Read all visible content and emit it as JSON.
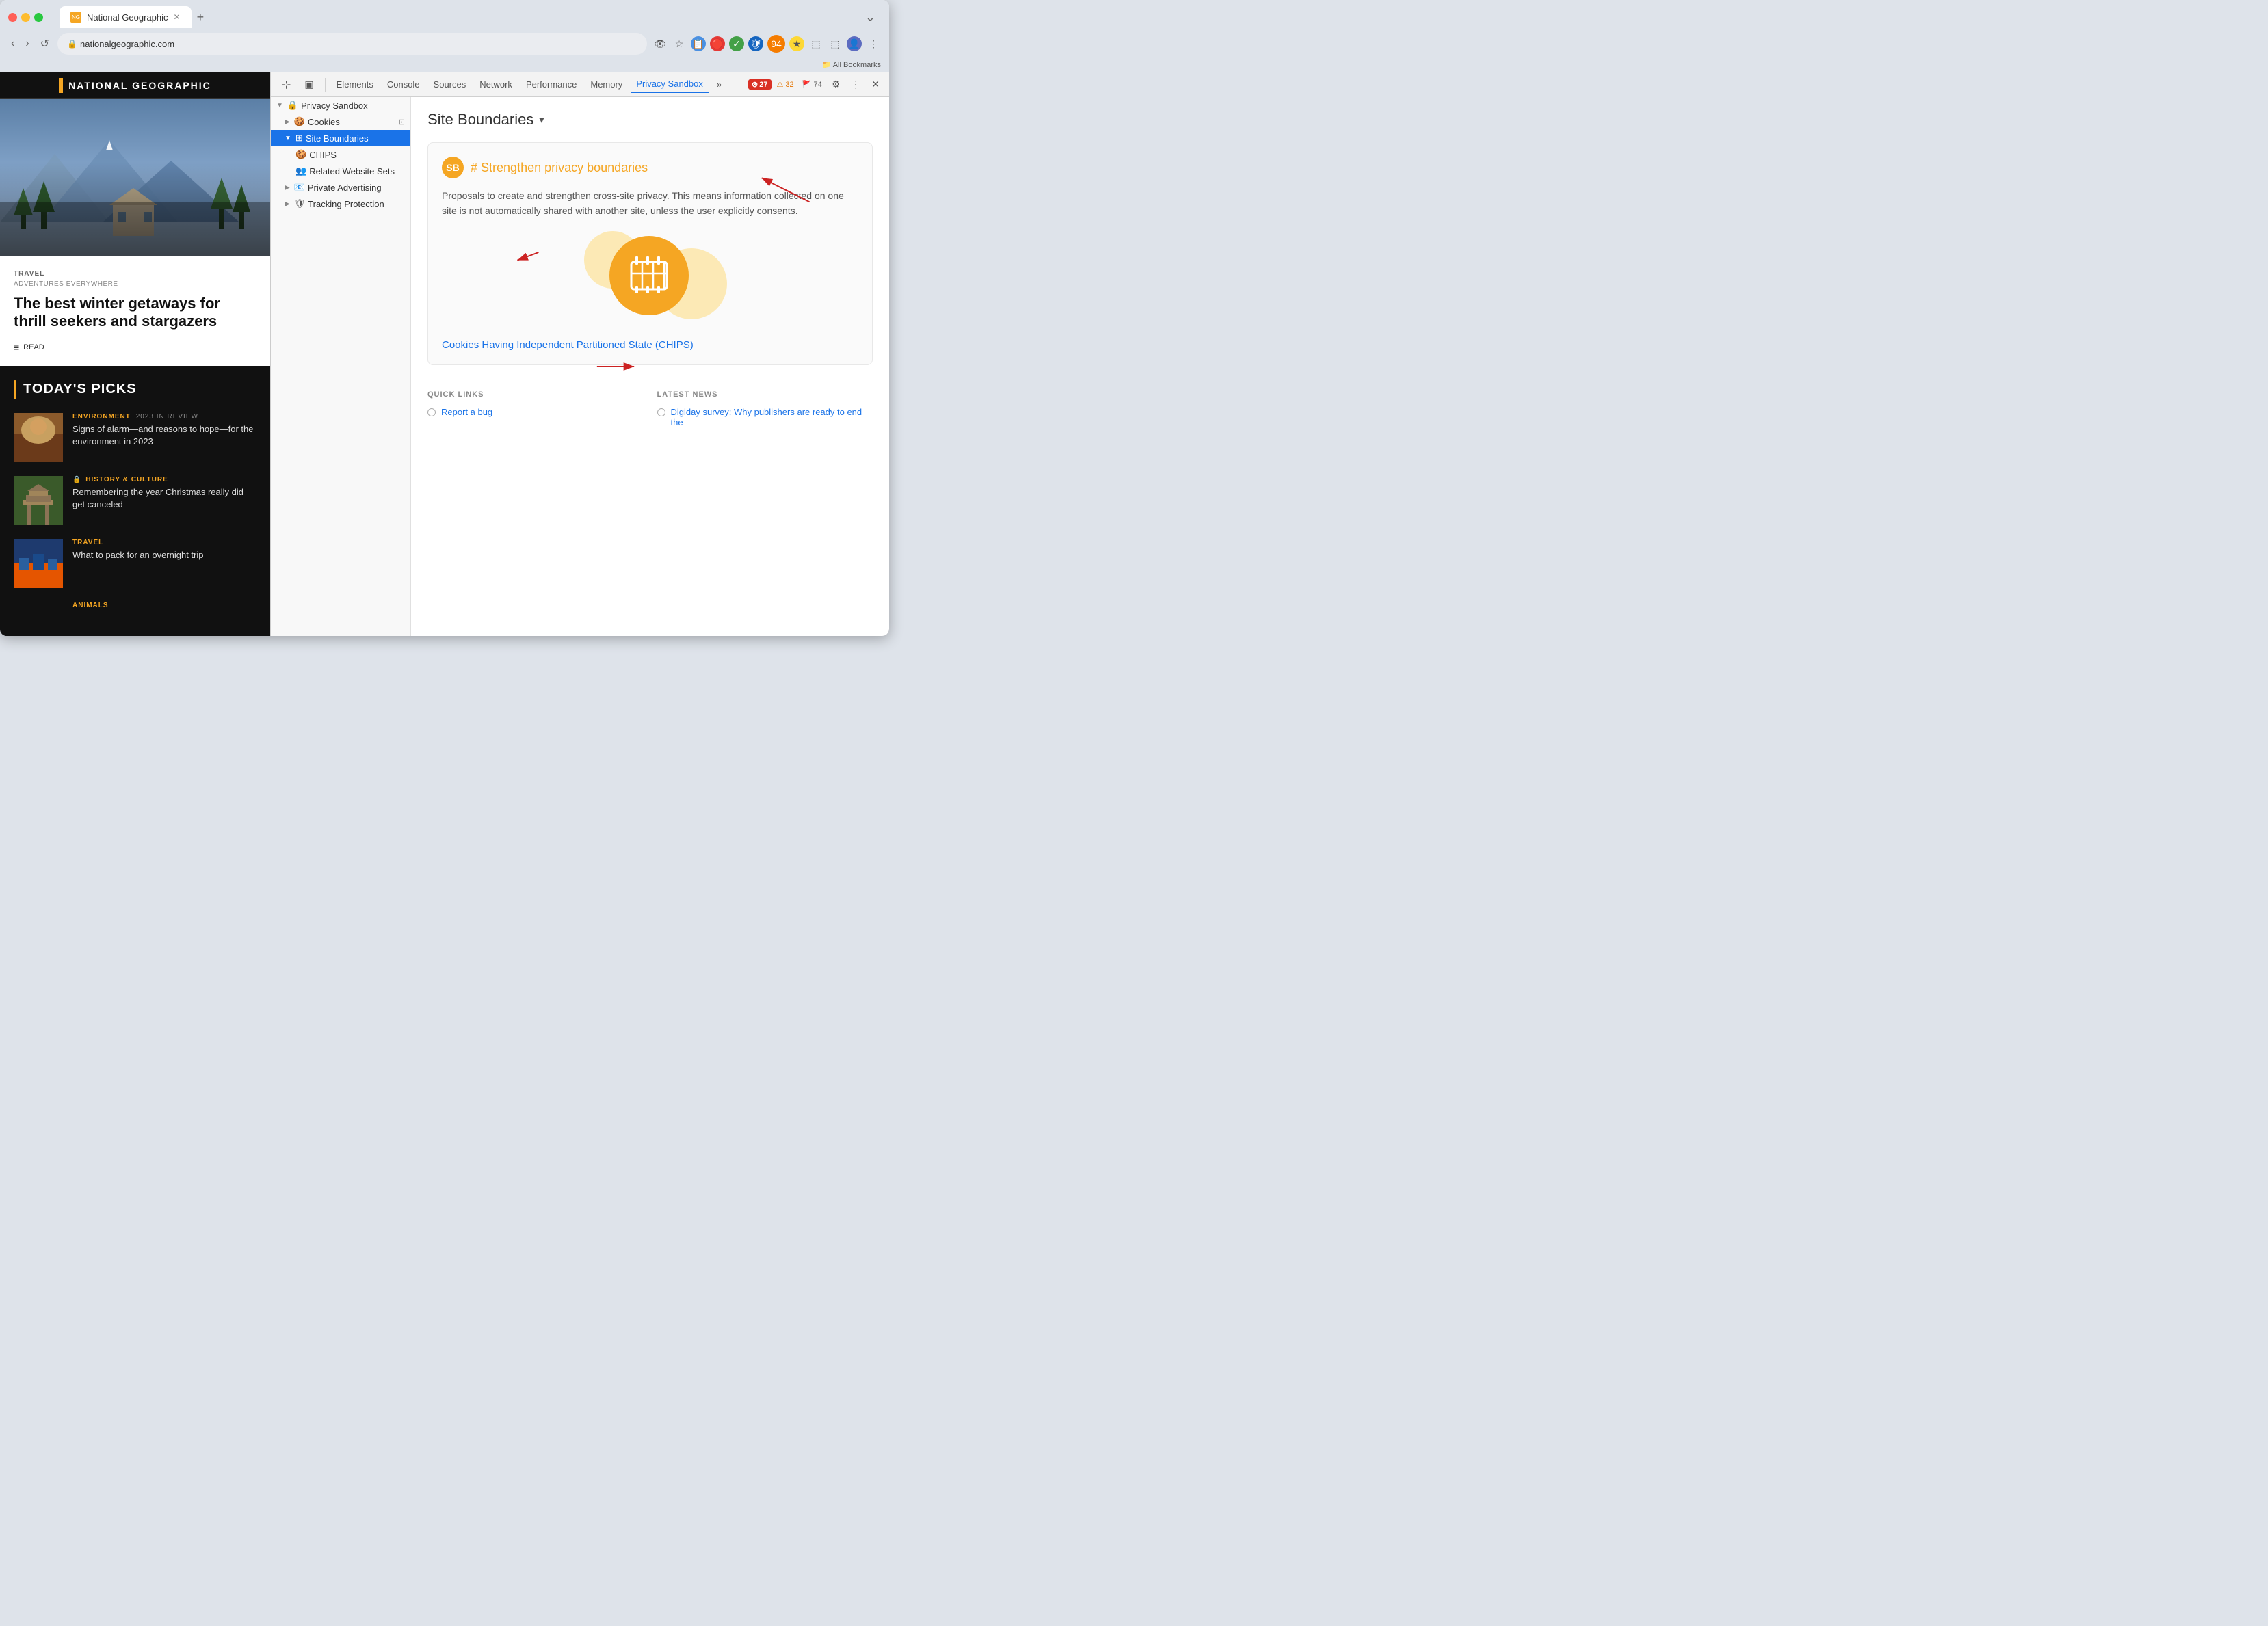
{
  "browser": {
    "tab_title": "National Geographic",
    "tab_favicon": "NG",
    "address": "nationalgeographic.com",
    "bookmark_label": "All Bookmarks",
    "new_tab_label": "+",
    "nav_back": "‹",
    "nav_forward": "›",
    "nav_reload": "↺"
  },
  "devtools": {
    "toolbar": {
      "cursor_icon": "⊹",
      "inspector_icon": "▣",
      "elements_label": "Elements",
      "console_label": "Console",
      "sources_label": "Sources",
      "network_label": "Network",
      "performance_label": "Performance",
      "memory_label": "Memory",
      "privacy_sandbox_label": "Privacy Sandbox",
      "more_tabs": "»",
      "error_count": "27",
      "warn_count": "32",
      "info_count": "74",
      "settings_icon": "⚙",
      "more_icon": "⋮",
      "close_icon": "✕"
    },
    "tree": {
      "privacy_sandbox_label": "Privacy Sandbox",
      "cookies_label": "Cookies",
      "site_boundaries_label": "Site Boundaries",
      "chips_label": "CHIPS",
      "related_website_sets_label": "Related Website Sets",
      "private_advertising_label": "Private Advertising",
      "tracking_protection_label": "Tracking Protection"
    },
    "main": {
      "page_title": "Site Boundaries",
      "page_title_arrow": "▾",
      "strengthen_card": {
        "icon_label": "SB",
        "title_hash": "#",
        "title_text": "Strengthen privacy boundaries",
        "description": "Proposals to create and strengthen cross-site privacy. This means information collected on one site is not automatically shared with another site, unless the user explicitly consents.",
        "chips_link": "Cookies Having Independent Partitioned State (CHIPS)"
      },
      "quick_links": {
        "header": "QUICK LINKS",
        "items": [
          {
            "label": "Report a bug"
          }
        ]
      },
      "latest_news": {
        "header": "LATEST NEWS",
        "items": [
          {
            "label": "Digiday survey: Why publishers are ready to end the"
          }
        ]
      }
    }
  },
  "website": {
    "logo_text": "National Geographic",
    "hero": {
      "eyebrow": "TRAVEL",
      "subtitle": "ADVENTURES EVERYWHERE",
      "title": "The best winter getaways for thrill seekers and stargazers",
      "read_label": "READ"
    },
    "today_picks": {
      "section_title": "TODAY'S PICKS",
      "articles": [
        {
          "category": "ENVIRONMENT",
          "year_tag": "2023 IN REVIEW",
          "title": "Signs of alarm—and reasons to hope—for the environment in 2023",
          "thumb_type": "env"
        },
        {
          "category": "HISTORY & CULTURE",
          "lock": true,
          "title": "Remembering the year Christmas really did get canceled",
          "thumb_type": "hist"
        },
        {
          "category": "TRAVEL",
          "title": "What to pack for an overnight trip",
          "thumb_type": "travel"
        }
      ],
      "animals_label": "ANIMALS"
    }
  }
}
